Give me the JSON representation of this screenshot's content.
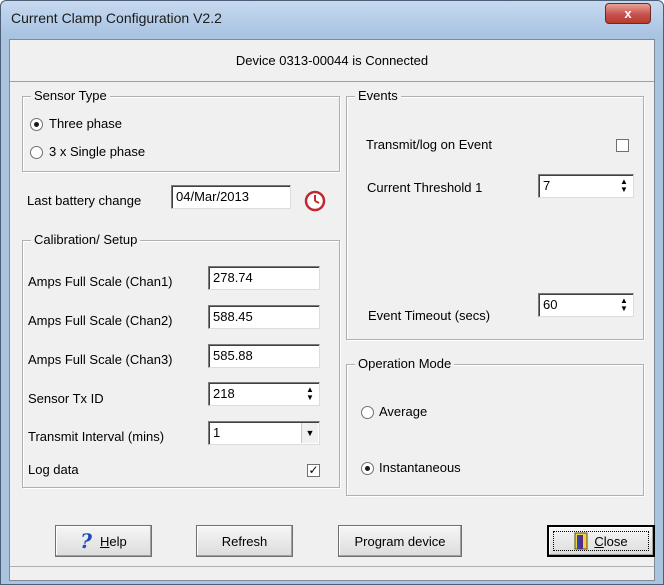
{
  "window": {
    "title": "Current Clamp Configuration V2.2",
    "close_glyph": "x"
  },
  "status": {
    "connection": "Device 0313-00044 is Connected"
  },
  "sensor_type": {
    "title": "Sensor Type",
    "option_three": "Three phase",
    "option_single": "3  x Single phase",
    "selected": "three"
  },
  "battery": {
    "label": "Last battery change",
    "value": "04/Mar/2013"
  },
  "calibration": {
    "title": "Calibration/ Setup",
    "chan1_label": "Amps Full Scale (Chan1)",
    "chan1_value": "278.74",
    "chan2_label": "Amps Full Scale (Chan2)",
    "chan2_value": "588.45",
    "chan3_label": "Amps Full Scale (Chan3)",
    "chan3_value": "585.88",
    "sensor_id_label": "Sensor Tx ID",
    "sensor_id_value": "218",
    "interval_label": "Transmit Interval (mins)",
    "interval_value": "1",
    "log_label": "Log data",
    "log_checked": true
  },
  "events": {
    "title": "Events",
    "transmit_label": "Transmit/log on Event",
    "transmit_checked": false,
    "threshold_label": "Current Threshold 1",
    "threshold_value": "7",
    "timeout_label": "Event Timeout (secs)",
    "timeout_value": "60"
  },
  "operation_mode": {
    "title": "Operation Mode",
    "option_average": "Average",
    "option_instant": "Instantaneous",
    "selected": "instantaneous"
  },
  "buttons": {
    "help_first": "H",
    "help_rest": "elp",
    "refresh": "Refresh",
    "program": "Program device",
    "close_first": "C",
    "close_rest": "lose"
  },
  "icons": {
    "help": "question-mark-icon",
    "clock": "clock-icon",
    "close": "door-exit-icon"
  },
  "colors": {
    "title_bar": "#aac3df",
    "close_button": "#c75050",
    "help_icon": "#1d4bb8",
    "clock_icon": "#c0282d"
  }
}
